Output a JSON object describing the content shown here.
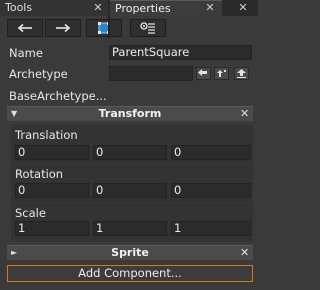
{
  "tabs": {
    "tools_label": "Tools",
    "properties_label": "Properties",
    "close_glyph": "✕"
  },
  "toolbar": {
    "icons": [
      "back-arrow-icon",
      "forward-arrow-icon",
      "select-frame-icon",
      "properties-list-icon"
    ]
  },
  "properties": {
    "name_label": "Name",
    "name_value": "ParentSquare",
    "archetype_label": "Archetype",
    "archetype_value": "",
    "base_archetype_label": "BaseArchetype..."
  },
  "transform": {
    "title": "Transform",
    "translation_label": "Translation",
    "translation": [
      "0",
      "0",
      "0"
    ],
    "rotation_label": "Rotation",
    "rotation": [
      "0",
      "0",
      "0"
    ],
    "scale_label": "Scale",
    "scale": [
      "1",
      "1",
      "1"
    ]
  },
  "sprite": {
    "title": "Sprite"
  },
  "add_component_label": "Add Component...",
  "colors": {
    "accent": "#d37a1f",
    "background": "#3a3a3a",
    "field": "#2b2b2b"
  }
}
